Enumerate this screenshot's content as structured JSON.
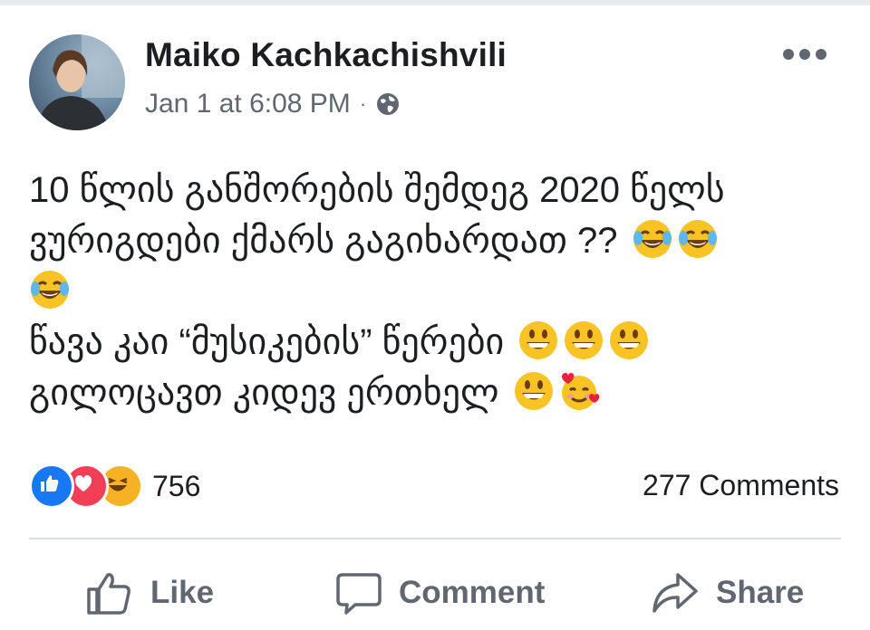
{
  "post": {
    "author": "Maiko Kachkachishvili",
    "timestamp": "Jan 1 at 6:08 PM",
    "separator": "·",
    "privacy_icon": "globe-icon",
    "content_lines": [
      "10 წლის განშორების შემდეგ 2020 წელს",
      "ვურიგდები ქმარს გაგიხარდათ ??",
      "",
      "წავა კაი “მუსიკების” წერები",
      "გილოცავთ კიდევ ერთხელ"
    ],
    "emojis": [
      "laughing-tears-emoji",
      "grinning-emoji",
      "smiling-hearts-emoji"
    ]
  },
  "reactions": {
    "icons": [
      "like-reaction-icon",
      "love-reaction-icon",
      "haha-reaction-icon"
    ],
    "count": "756"
  },
  "comments": {
    "count_label": "277 Comments"
  },
  "actions": {
    "like": "Like",
    "comment": "Comment",
    "share": "Share"
  },
  "colors": {
    "like_blue": "#1877f2",
    "love_red": "#f33e58",
    "haha_yellow": "#f7b125",
    "muted": "#606770"
  }
}
